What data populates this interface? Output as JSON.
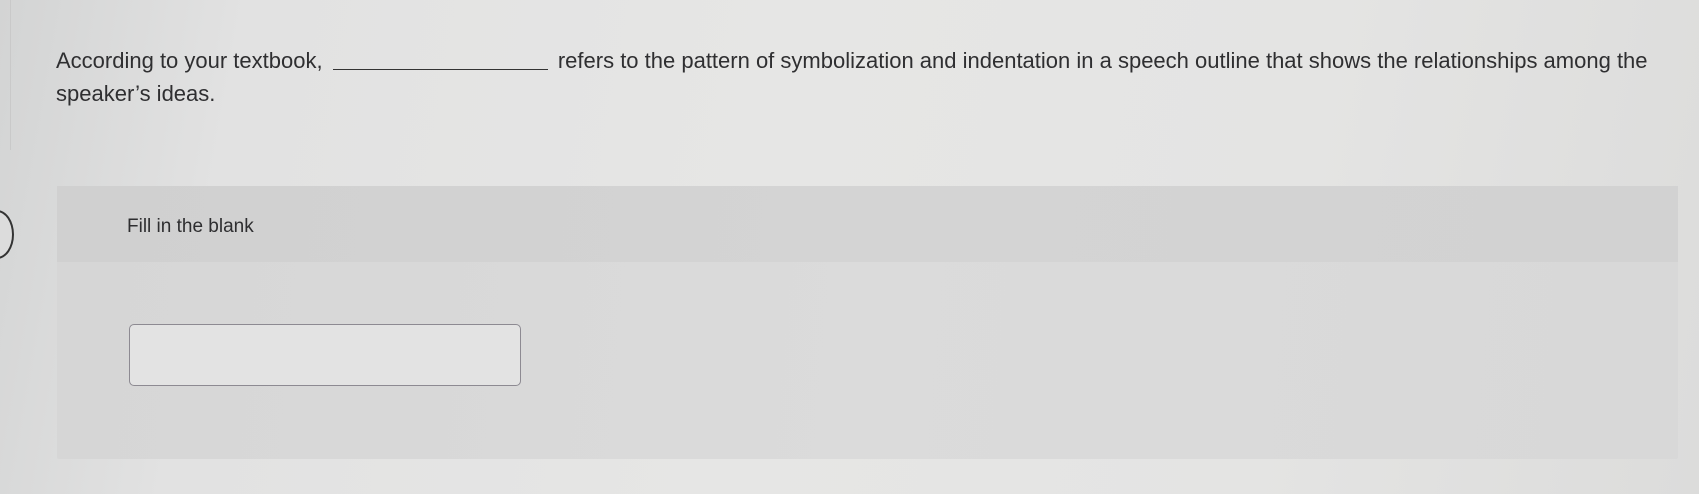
{
  "question": {
    "text_before_blank": "According to your textbook,",
    "text_after_blank": "refers to the pattern of symbolization and indentation in a speech outline that shows the relationships among the speaker’s ideas."
  },
  "answer_panel": {
    "title": "Fill in the blank",
    "input_value": "",
    "input_placeholder": ""
  }
}
